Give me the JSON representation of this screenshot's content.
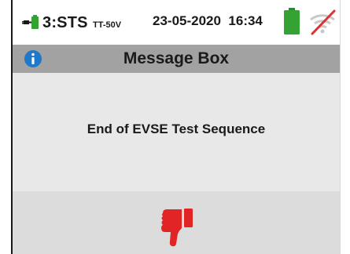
{
  "status": {
    "mode_label": "3:STS",
    "mode_sub": "TT-50V",
    "datetime": "23-05-2020  16:34",
    "icons": {
      "mode": "probe-plug-icon",
      "battery": "battery-icon",
      "signal": "wifi-off-icon"
    }
  },
  "header": {
    "title": "Message Box",
    "icon": "info-icon"
  },
  "message": {
    "text": "End of EVSE Test Sequence"
  },
  "result": {
    "icon": "thumbs-down-icon",
    "status": "fail"
  },
  "colors": {
    "battery": "#34a334",
    "thumb": "#e12424",
    "info": "#1f78c8",
    "title_bar": "#a2a2a2",
    "message_bg": "#e8e8e8",
    "result_bg": "#dcdcdc",
    "wifi_cross": "#e03030"
  }
}
